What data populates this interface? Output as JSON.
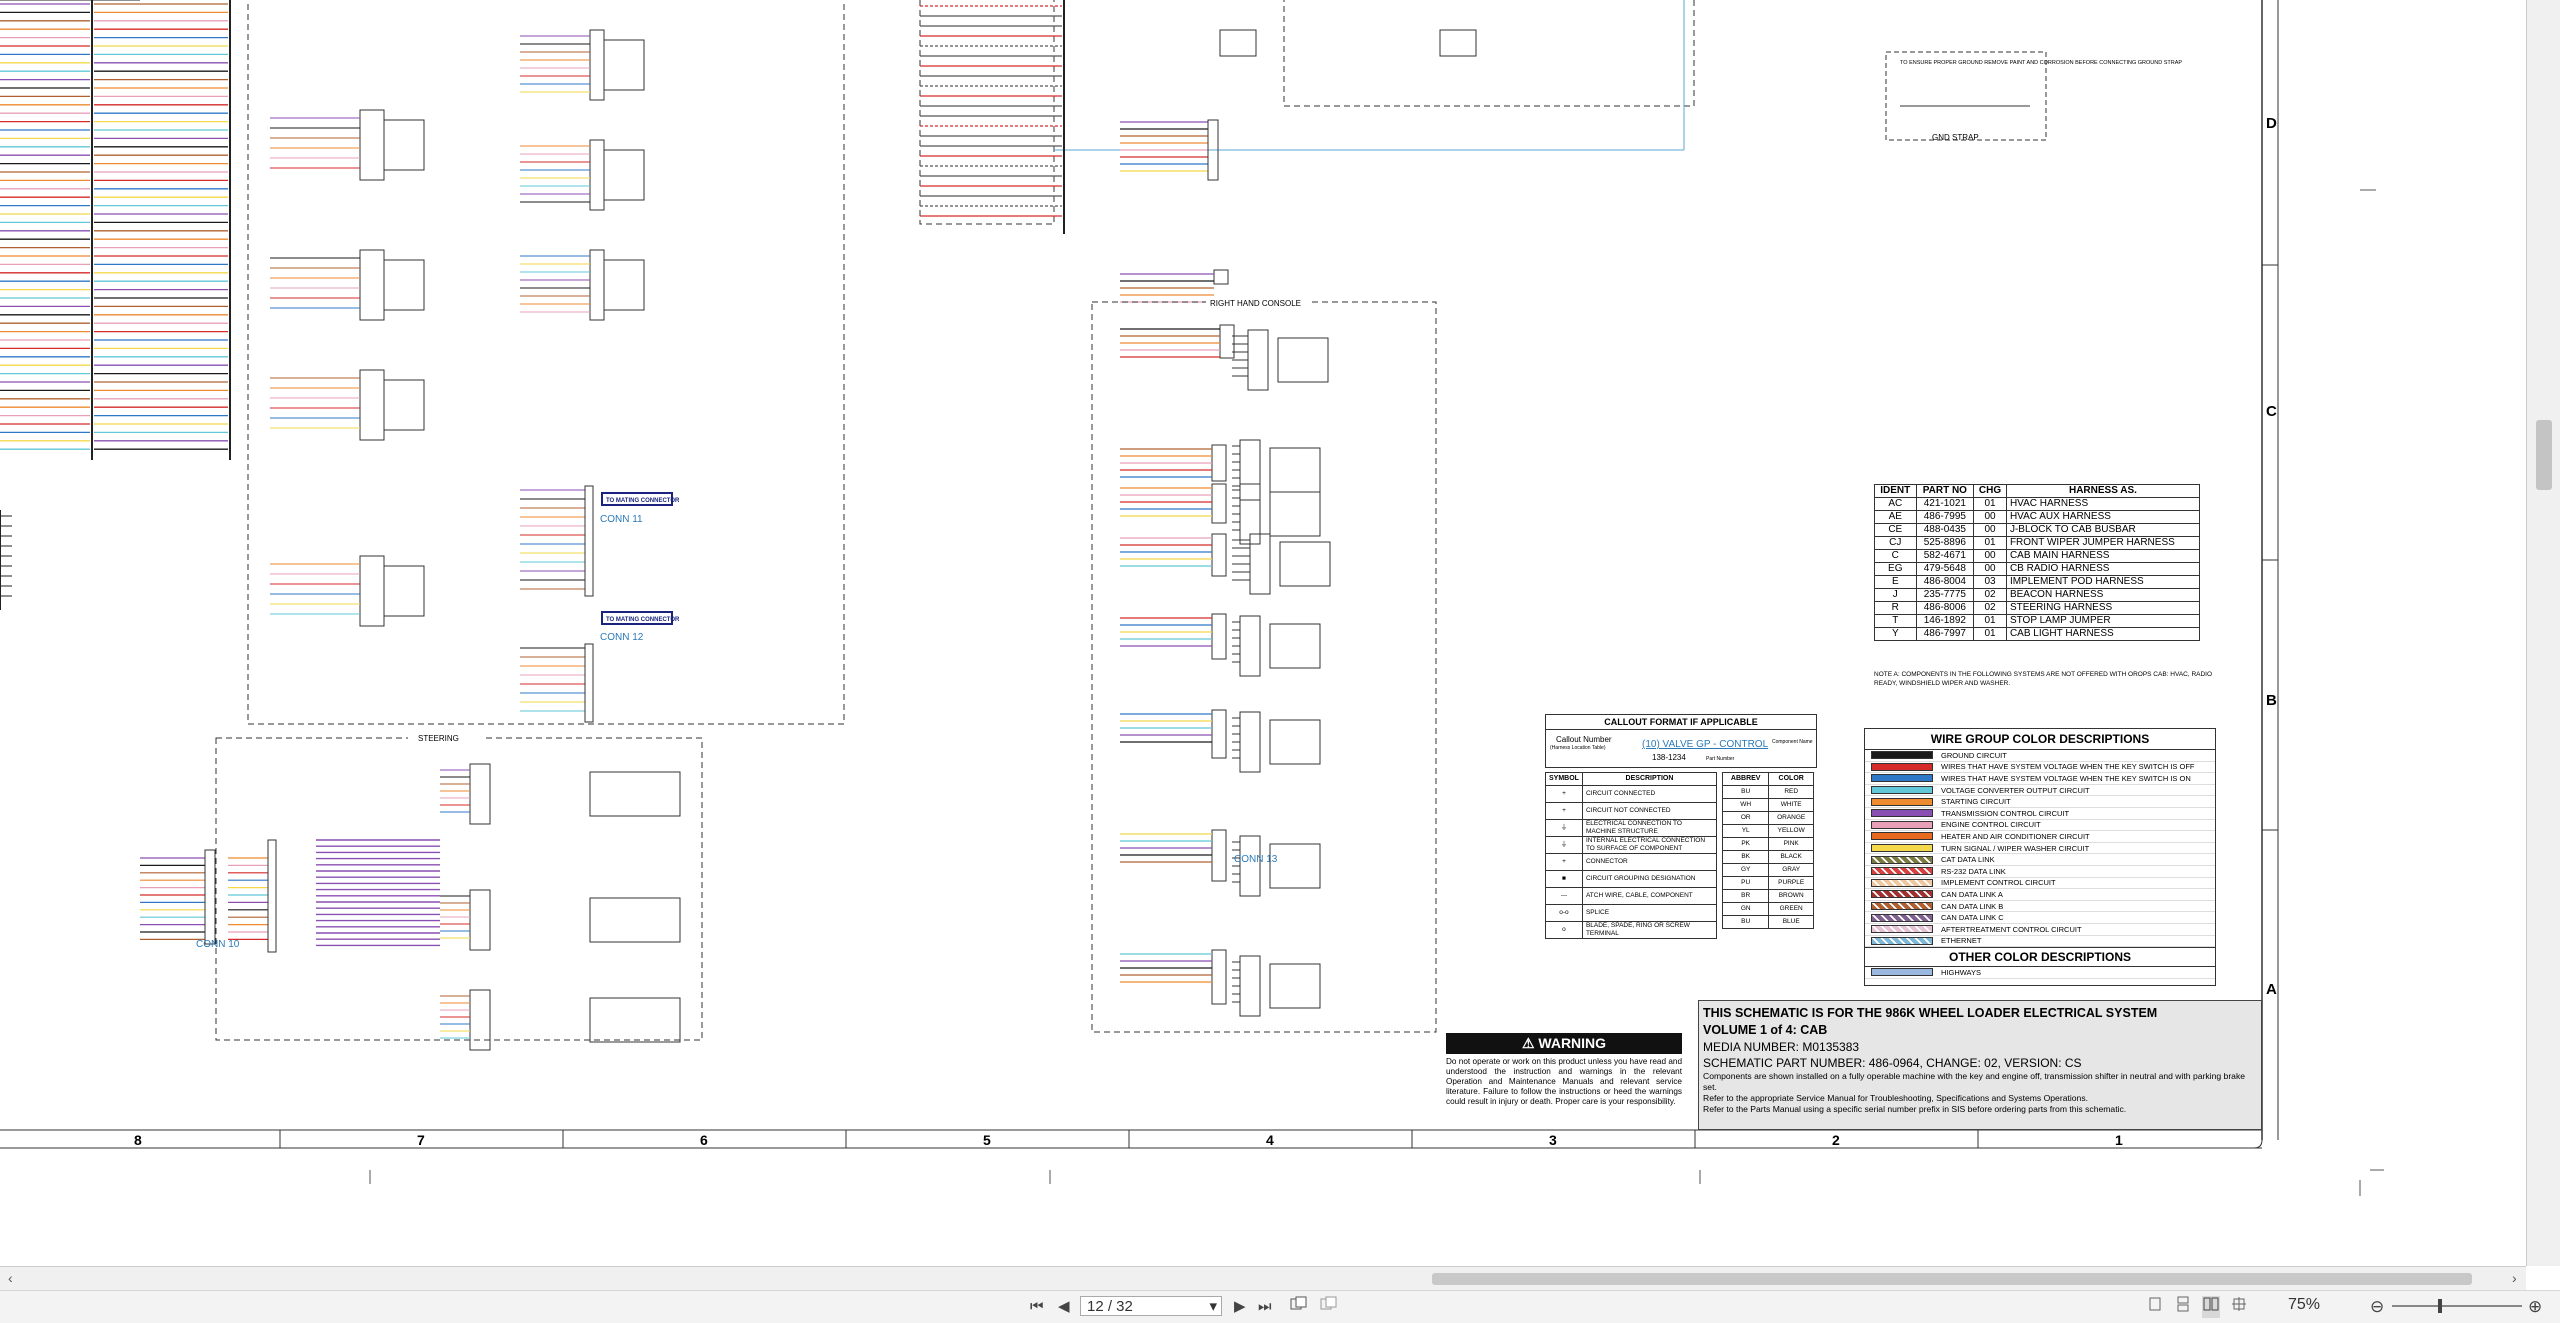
{
  "schematic": {
    "row_labels": [
      "D",
      "C",
      "B",
      "A"
    ],
    "col_labels": [
      "8",
      "7",
      "6",
      "5",
      "4",
      "3",
      "2",
      "1"
    ],
    "group_labels": {
      "steering": "STEERING",
      "right_hand_console": "RIGHT HAND CONSOLE",
      "gnd_strap": "GND STRAP"
    },
    "connectors": {
      "conn10": "CONN 10",
      "conn11": "CONN 11",
      "conn12": "CONN 12",
      "conn13": "CONN 13",
      "to_mating": "TO MATING CONNECTOR"
    },
    "harness_table": {
      "headers": [
        "IDENT",
        "PART NO",
        "CHG",
        "HARNESS AS."
      ],
      "rows": [
        [
          "AC",
          "421-1021",
          "01",
          "HVAC HARNESS"
        ],
        [
          "AE",
          "486-7995",
          "00",
          "HVAC AUX HARNESS"
        ],
        [
          "CE",
          "488-0435",
          "00",
          "J-BLOCK TO CAB BUSBAR"
        ],
        [
          "CJ",
          "525-8896",
          "01",
          "FRONT WIPER JUMPER HARNESS"
        ],
        [
          "C",
          "582-4671",
          "00",
          "CAB MAIN HARNESS"
        ],
        [
          "EG",
          "479-5648",
          "00",
          "CB RADIO HARNESS"
        ],
        [
          "E",
          "486-8004",
          "03",
          "IMPLEMENT POD HARNESS"
        ],
        [
          "J",
          "235-7775",
          "02",
          "BEACON HARNESS"
        ],
        [
          "R",
          "486-8006",
          "02",
          "STEERING HARNESS"
        ],
        [
          "T",
          "146-1892",
          "01",
          "STOP LAMP JUMPER"
        ],
        [
          "Y",
          "486-7997",
          "01",
          "CAB LIGHT HARNESS"
        ]
      ]
    },
    "note": "NOTE A: COMPONENTS IN THE FOLLOWING SYSTEMS ARE NOT OFFERED WITH OROPS CAB: HVAC, RADIO READY, WINDSHIELD WIPER AND WASHER.",
    "wire_groups": {
      "title": "WIRE GROUP COLOR DESCRIPTIONS",
      "items": [
        {
          "label": "GROUND CIRCUIT",
          "color": "#1a1a1a"
        },
        {
          "label": "WIRES THAT HAVE SYSTEM VOLTAGE WHEN THE KEY SWITCH IS OFF",
          "color": "#d42a2a"
        },
        {
          "label": "WIRES THAT HAVE SYSTEM VOLTAGE WHEN THE KEY SWITCH IS ON",
          "color": "#2f78c8"
        },
        {
          "label": "VOLTAGE CONVERTER OUTPUT CIRCUIT",
          "color": "#62c8d8"
        },
        {
          "label": "STARTING CIRCUIT",
          "color": "#ee8a30"
        },
        {
          "label": "TRANSMISSION CONTROL CIRCUIT",
          "color": "#8a4fb2"
        },
        {
          "label": "ENGINE CONTROL CIRCUIT",
          "color": "#e8a0b8"
        },
        {
          "label": "HEATER AND AIR CONDITIONER CIRCUIT",
          "color": "#e86a20"
        },
        {
          "label": "TURN SIGNAL / WIPER WASHER CIRCUIT",
          "color": "#f2d84a"
        },
        {
          "label": "CAT DATA LINK",
          "color": "#7a7a40"
        },
        {
          "label": "RS-232 DATA LINK",
          "color": "#d84040"
        },
        {
          "label": "IMPLEMENT CONTROL CIRCUIT",
          "color": "#f0c8a0"
        },
        {
          "label": "CAN DATA LINK A",
          "color": "#a03030"
        },
        {
          "label": "CAN DATA LINK B",
          "color": "#b06030"
        },
        {
          "label": "CAN DATA LINK C",
          "color": "#806090"
        },
        {
          "label": "AFTERTREATMENT CONTROL CIRCUIT",
          "color": "#e6c2d4"
        },
        {
          "label": "ETHERNET",
          "color": "#7eb8d8"
        }
      ],
      "other_title": "OTHER COLOR DESCRIPTIONS",
      "other_items": [
        {
          "label": "HIGHWAYS",
          "color": "#9ab8e0"
        }
      ]
    },
    "callout": {
      "title": "CALLOUT FORMAT IF APPLICABLE",
      "callout_number": "Callout Number",
      "component_location": "(Harness Location Table)",
      "example_name": "(10) VALVE GP - CONTROL",
      "example_part": "138-1234",
      "component_name": "Component Name",
      "part_number": "Part Number"
    },
    "symbols": {
      "headers": [
        "SYMBOL",
        "DESCRIPTION"
      ],
      "rows": [
        [
          "+",
          "CIRCUIT CONNECTED"
        ],
        [
          "+",
          "CIRCUIT NOT CONNECTED"
        ],
        [
          "⏚",
          "ELECTRICAL CONNECTION TO MACHINE STRUCTURE"
        ],
        [
          "⏚",
          "INTERNAL ELECTRICAL CONNECTION TO SURFACE OF COMPONENT"
        ],
        [
          "+",
          "CONNECTOR"
        ],
        [
          "■",
          "CIRCUIT GROUPING DESIGNATION"
        ],
        [
          "---",
          "ATCH WIRE, CABLE, COMPONENT"
        ],
        [
          "o-o",
          "SPLICE"
        ],
        [
          "o",
          "BLADE, SPADE, RING OR SCREW TERMINAL"
        ]
      ]
    },
    "abbrev": {
      "headers": [
        "ABBREV",
        "COLOR"
      ],
      "rows": [
        [
          "BU",
          "RED"
        ],
        [
          "WH",
          "WHITE"
        ],
        [
          "OR",
          "ORANGE"
        ],
        [
          "YL",
          "YELLOW"
        ],
        [
          "PK",
          "PINK"
        ],
        [
          "BK",
          "BLACK"
        ],
        [
          "GY",
          "GRAY"
        ],
        [
          "PU",
          "PURPLE"
        ],
        [
          "BR",
          "BROWN"
        ],
        [
          "GN",
          "GREEN"
        ],
        [
          "BU",
          "BLUE"
        ]
      ]
    },
    "warning": {
      "title": "WARNING",
      "text": "Do not operate or work on this product unless you have read and understood the instruction and warnings in the relevant Operation and Maintenance Manuals and relevant service literature. Failure to follow the instructions or heed the warnings could result in injury or death. Proper care is your responsibility."
    },
    "title_block": {
      "line1": "THIS SCHEMATIC IS FOR THE 986K WHEEL LOADER ELECTRICAL SYSTEM",
      "line2": "VOLUME 1 of 4: CAB",
      "media": "MEDIA NUMBER: M0135383",
      "part": "SCHEMATIC PART NUMBER: 486-0964, CHANGE: 02, VERSION: CS",
      "note1": "Components are shown installed on a fully operable machine with the key and engine off, transmission shifter in neutral and with parking brake set.",
      "note2": "Refer to the appropriate Service Manual for Troubleshooting, Specifications and Systems Operations.",
      "note3": "Refer to the Parts Manual using a specific serial number prefix in SIS before ordering parts from this schematic."
    },
    "gnd_text": "TO ENSURE PROPER GROUND REMOVE PAINT AND CORROSION BEFORE CONNECTING GROUND STRAP"
  },
  "toolbar": {
    "page_value": "12 / 32",
    "zoom": "75%",
    "first_page": "⏮",
    "prev_page": "◀",
    "next_page": "▶",
    "last_page": "⏭",
    "dropdown": "▾",
    "zoom_out": "⊖",
    "zoom_in": "⊕"
  }
}
